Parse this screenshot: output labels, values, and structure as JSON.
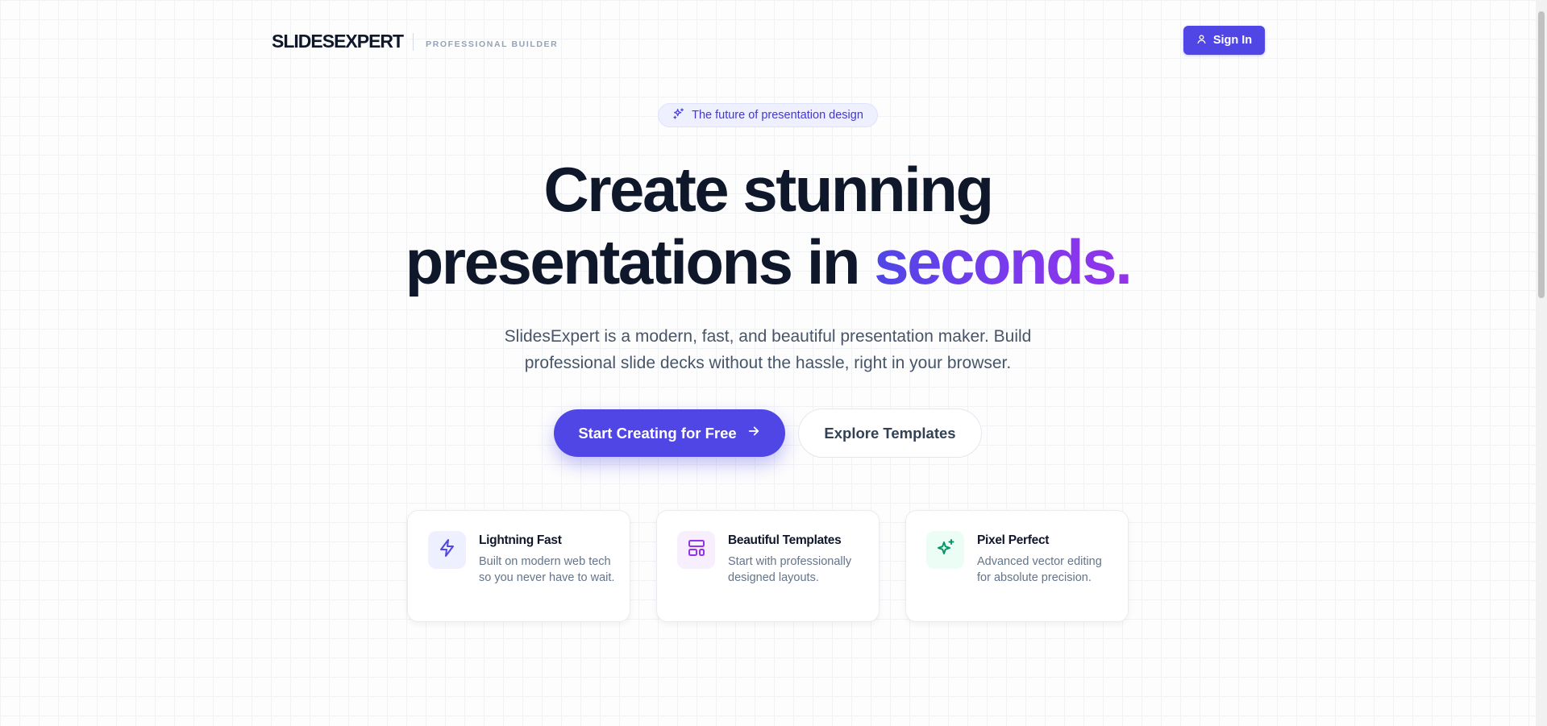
{
  "header": {
    "logo": "SLIDESEXPERT",
    "tagline": "PROFESSIONAL BUILDER",
    "signin_label": "Sign In",
    "signin_icon": "user-icon"
  },
  "badge": {
    "icon": "sparkles-icon",
    "text": "The future of presentation design"
  },
  "hero": {
    "title_line1": "Create stunning",
    "title_line2_prefix": "presentations in ",
    "title_accent": "seconds.",
    "subtitle_line1": "SlidesExpert is a modern, fast, and beautiful presentation maker. Build",
    "subtitle_line2": "professional slide decks without the hassle, right in your browser."
  },
  "cta": {
    "primary_label": "Start Creating for Free",
    "primary_icon": "arrow-right-icon",
    "secondary_label": "Explore Templates"
  },
  "features": [
    {
      "title": "Lightning Fast",
      "description": "Built on modern web tech so you never have to wait.",
      "icon": "lightning-icon",
      "color": "#4f46e5",
      "bg": "#eef0ff"
    },
    {
      "title": "Beautiful Templates",
      "description": "Start with professionally designed layouts.",
      "icon": "layout-template-icon",
      "color": "#9333ea",
      "bg": "#f7eefe"
    },
    {
      "title": "Pixel Perfect",
      "description": "Advanced vector editing for absolute precision.",
      "icon": "sparkles-icon",
      "color": "#059669",
      "bg": "#ecfdf5"
    }
  ],
  "colors": {
    "brand": "#4f46e5",
    "accent_purple": "#9333ea",
    "text_dark": "#0f172a",
    "text_muted": "#64748b"
  }
}
